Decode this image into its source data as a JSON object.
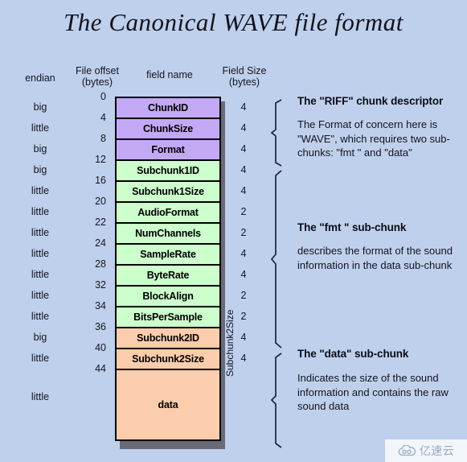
{
  "title": "The Canonical WAVE file format",
  "colors": {
    "background": "#bed0ec",
    "riff_chunk": "#c3a9f5",
    "fmt_chunk": "#ccffcc",
    "data_chunk": "#fbcdac",
    "border": "#000000",
    "shadow": "#6b6b78"
  },
  "headers": {
    "endian": "endian",
    "file_offset_line1": "File offset",
    "file_offset_line2": "(bytes)",
    "field_name": "field name",
    "field_size_line1": "Field Size",
    "field_size_line2": "(bytes)"
  },
  "vertical_label": "Subchunk2Size",
  "rows": [
    {
      "endian": "big",
      "offset": "0",
      "field": "ChunkID",
      "size": "4",
      "group": "riff"
    },
    {
      "endian": "little",
      "offset": "4",
      "field": "ChunkSize",
      "size": "4",
      "group": "riff"
    },
    {
      "endian": "big",
      "offset": "8",
      "field": "Format",
      "size": "4",
      "group": "riff"
    },
    {
      "endian": "big",
      "offset": "12",
      "field": "Subchunk1ID",
      "size": "4",
      "group": "fmt"
    },
    {
      "endian": "little",
      "offset": "16",
      "field": "Subchunk1Size",
      "size": "4",
      "group": "fmt"
    },
    {
      "endian": "little",
      "offset": "20",
      "field": "AudioFormat",
      "size": "2",
      "group": "fmt"
    },
    {
      "endian": "little",
      "offset": "22",
      "field": "NumChannels",
      "size": "2",
      "group": "fmt"
    },
    {
      "endian": "little",
      "offset": "24",
      "field": "SampleRate",
      "size": "4",
      "group": "fmt"
    },
    {
      "endian": "little",
      "offset": "28",
      "field": "ByteRate",
      "size": "4",
      "group": "fmt"
    },
    {
      "endian": "little",
      "offset": "32",
      "field": "BlockAlign",
      "size": "2",
      "group": "fmt"
    },
    {
      "endian": "little",
      "offset": "34",
      "field": "BitsPerSample",
      "size": "2",
      "group": "fmt"
    },
    {
      "endian": "big",
      "offset": "36",
      "field": "Subchunk2ID",
      "size": "4",
      "group": "data"
    },
    {
      "endian": "little",
      "offset": "40",
      "field": "Subchunk2Size",
      "size": "4",
      "group": "data"
    },
    {
      "endian": "little",
      "offset": "44",
      "field": "data",
      "size": "",
      "group": "data-big"
    }
  ],
  "notes": [
    {
      "title": "The \"RIFF\" chunk descriptor",
      "body": "The Format of concern here is \"WAVE\", which requires two sub-chunks: \"fmt \" and \"data\""
    },
    {
      "title": "The \"fmt \" sub-chunk",
      "body": "describes the format of the sound information in the data sub-chunk"
    },
    {
      "title": "The \"data\" sub-chunk",
      "body": "Indicates the size of the sound information and contains the raw sound data"
    }
  ],
  "watermark": {
    "text": "亿速云",
    "icon": "cloud-icon"
  }
}
